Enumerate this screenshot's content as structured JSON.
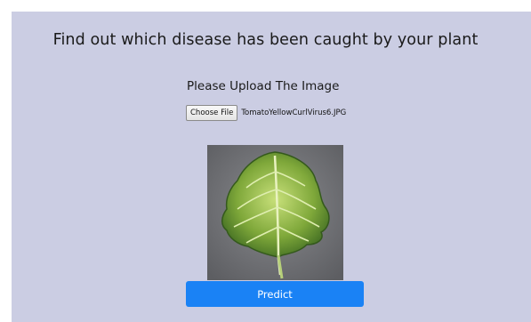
{
  "page": {
    "title": "Find out which disease has been caught by your plant",
    "background_color": "#cbcde3"
  },
  "upload": {
    "label": "Please Upload The Image",
    "choose_button_label": "Choose File",
    "selected_file_name": "TomatoYellowCurlVirus6.JPG"
  },
  "preview": {
    "icon": "leaf-image"
  },
  "actions": {
    "predict_label": "Predict",
    "predict_color": "#1a82f5"
  }
}
